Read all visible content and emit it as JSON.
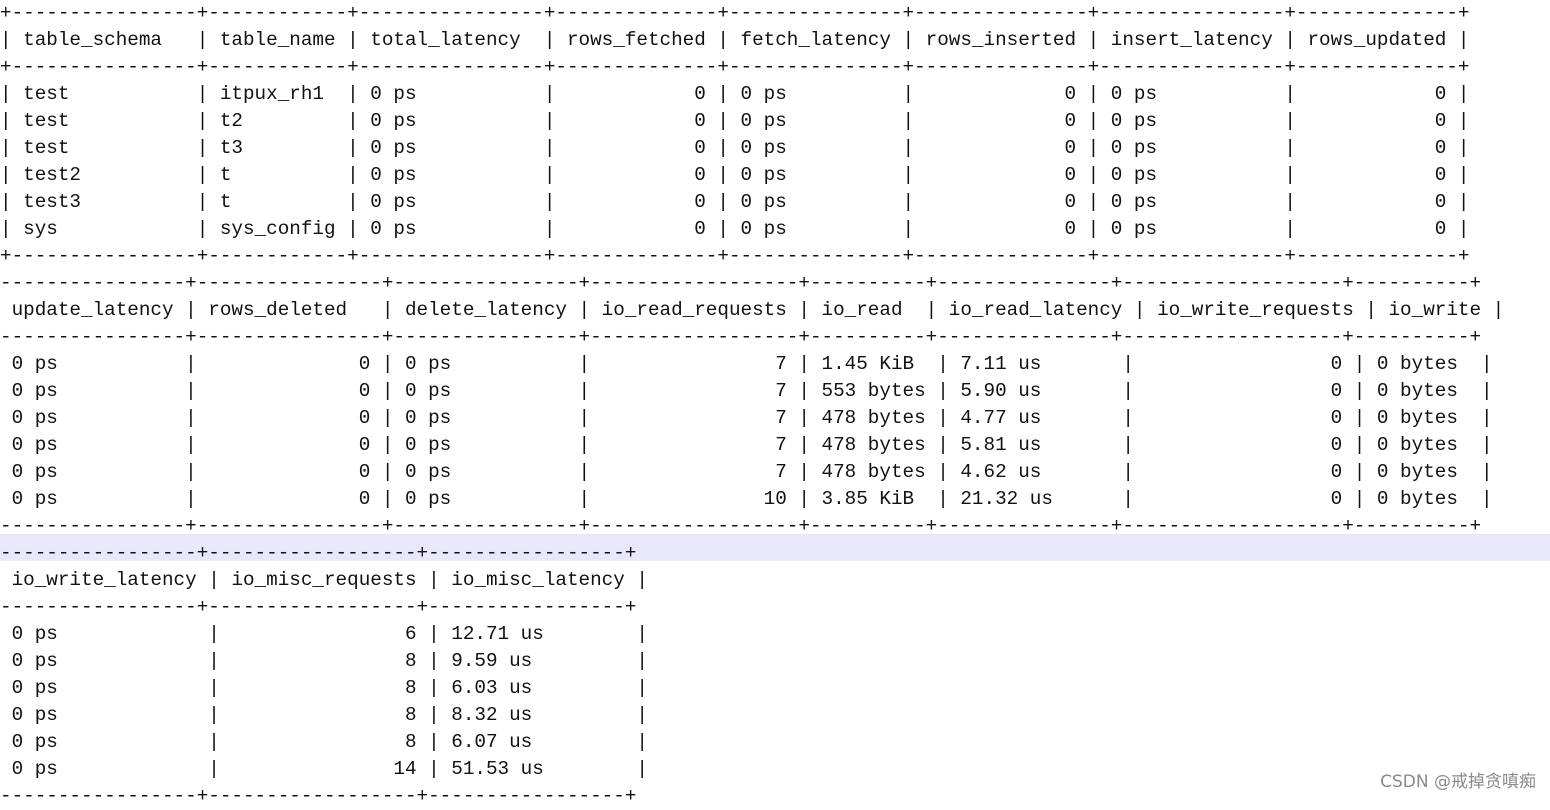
{
  "tables": [
    {
      "lines": [
        "+----------------+------------+----------------+--------------+---------------+---------------+----------------+--------------+",
        "| table_schema   | table_name | total_latency  | rows_fetched | fetch_latency | rows_inserted | insert_latency | rows_updated |",
        "+----------------+------------+----------------+--------------+---------------+---------------+----------------+--------------+",
        "| test           | itpux_rh1  | 0 ps           |            0 | 0 ps          |             0 | 0 ps           |            0 |",
        "| test           | t2         | 0 ps           |            0 | 0 ps          |             0 | 0 ps           |            0 |",
        "| test           | t3         | 0 ps           |            0 | 0 ps          |             0 | 0 ps           |            0 |",
        "| test2          | t          | 0 ps           |            0 | 0 ps          |             0 | 0 ps           |            0 |",
        "| test3          | t          | 0 ps           |            0 | 0 ps          |             0 | 0 ps           |            0 |",
        "| sys            | sys_config | 0 ps           |            0 | 0 ps          |             0 | 0 ps           |            0 |",
        "+----------------+------------+----------------+--------------+---------------+---------------+----------------+--------------+"
      ]
    },
    {
      "lines": [
        "----------------+----------------+----------------+------------------+----------+---------------+-------------------+----------+",
        " update_latency | rows_deleted   | delete_latency | io_read_requests | io_read  | io_read_latency | io_write_requests | io_write |",
        "----------------+----------------+----------------+------------------+----------+---------------+-------------------+----------+",
        " 0 ps           |              0 | 0 ps           |                7 | 1.45 KiB  | 7.11 us       |                 0 | 0 bytes  |",
        " 0 ps           |              0 | 0 ps           |                7 | 553 bytes | 5.90 us       |                 0 | 0 bytes  |",
        " 0 ps           |              0 | 0 ps           |                7 | 478 bytes | 4.77 us       |                 0 | 0 bytes  |",
        " 0 ps           |              0 | 0 ps           |                7 | 478 bytes | 5.81 us       |                 0 | 0 bytes  |",
        " 0 ps           |              0 | 0 ps           |                7 | 478 bytes | 4.62 us       |                 0 | 0 bytes  |",
        " 0 ps           |              0 | 0 ps           |               10 | 3.85 KiB  | 21.32 us      |                 0 | 0 bytes  |",
        "----------------+----------------+----------------+------------------+----------+---------------+-------------------+----------+"
      ]
    },
    {
      "lines": [
        "-----------------+------------------+-----------------+",
        " io_write_latency | io_misc_requests | io_misc_latency |",
        "-----------------+------------------+-----------------+",
        " 0 ps             |                6 | 12.71 us        |",
        " 0 ps             |                8 | 9.59 us         |",
        " 0 ps             |                8 | 6.03 us         |",
        " 0 ps             |                8 | 8.32 us         |",
        " 0 ps             |                8 | 6.07 us         |",
        " 0 ps             |               14 | 51.53 us        |",
        "-----------------+------------------+-----------------+"
      ]
    }
  ],
  "watermark": "CSDN @戒掉贪嗔痴"
}
